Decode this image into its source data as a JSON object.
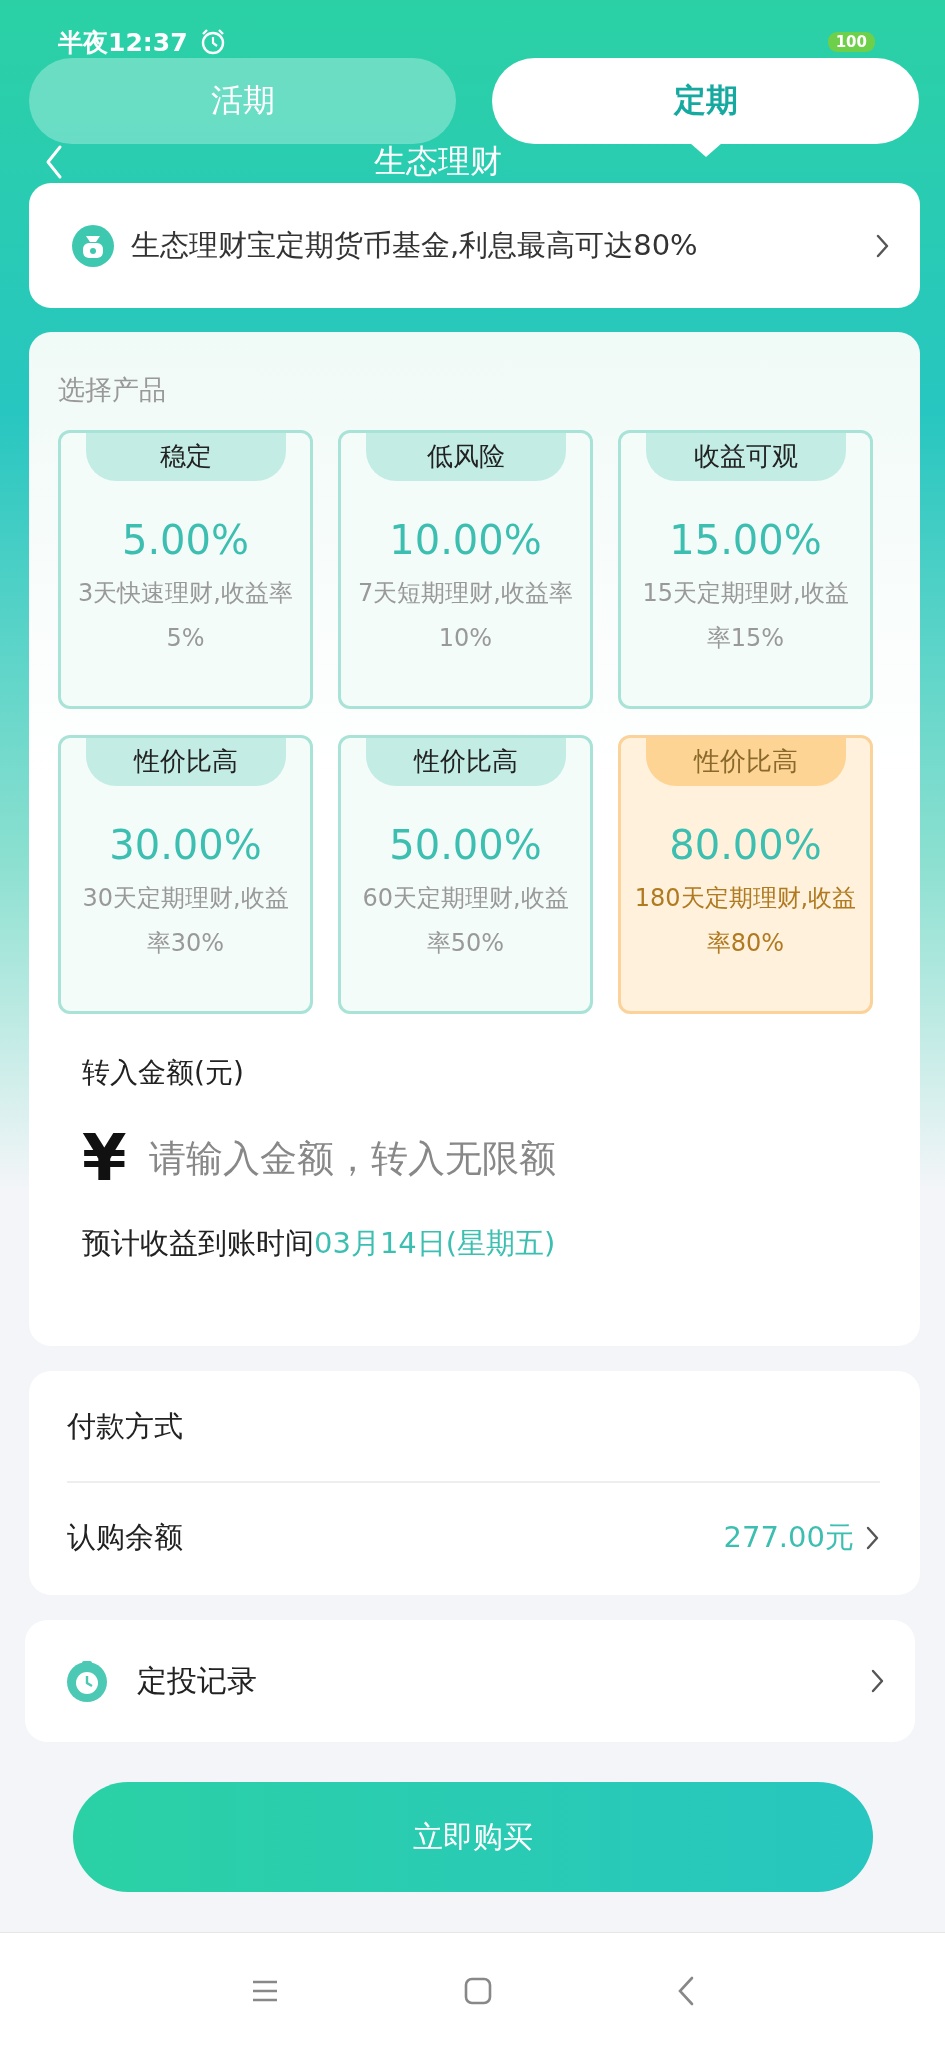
{
  "status_bar": {
    "time": "半夜12:37",
    "battery": "100"
  },
  "tabs": [
    {
      "label": "活期",
      "selected": false
    },
    {
      "label": "定期",
      "selected": true
    }
  ],
  "header": {
    "title": "生态理财"
  },
  "banner": {
    "text": "生态理财宝定期货币基金,利息最高可达80%"
  },
  "products": {
    "title": "选择产品",
    "items": [
      {
        "tag": "稳定",
        "rate": "5.00%",
        "desc": "3天快速理财,收益率5%",
        "selected": false
      },
      {
        "tag": "低风险",
        "rate": "10.00%",
        "desc": "7天短期理财,收益率10%",
        "selected": false
      },
      {
        "tag": "收益可观",
        "rate": "15.00%",
        "desc": "15天定期理财,收益率15%",
        "selected": false
      },
      {
        "tag": "性价比高",
        "rate": "30.00%",
        "desc": "30天定期理财,收益率30%",
        "selected": false
      },
      {
        "tag": "性价比高",
        "rate": "50.00%",
        "desc": "60天定期理财,收益率50%",
        "selected": false
      },
      {
        "tag": "性价比高",
        "rate": "80.00%",
        "desc": "180天定期理财,收益率80%",
        "selected": true
      }
    ]
  },
  "amount": {
    "label": "转入金额(元)",
    "currency": "¥",
    "placeholder": "请输入金额，转入无限额",
    "arrival_label": "预计收益到账时间",
    "arrival_date": "03月14日(星期五)"
  },
  "payment": {
    "title": "付款方式",
    "balance_label": "认购余额",
    "balance": "277.00元"
  },
  "record": {
    "label": "定投记录"
  },
  "buy_button": "立即购买"
}
